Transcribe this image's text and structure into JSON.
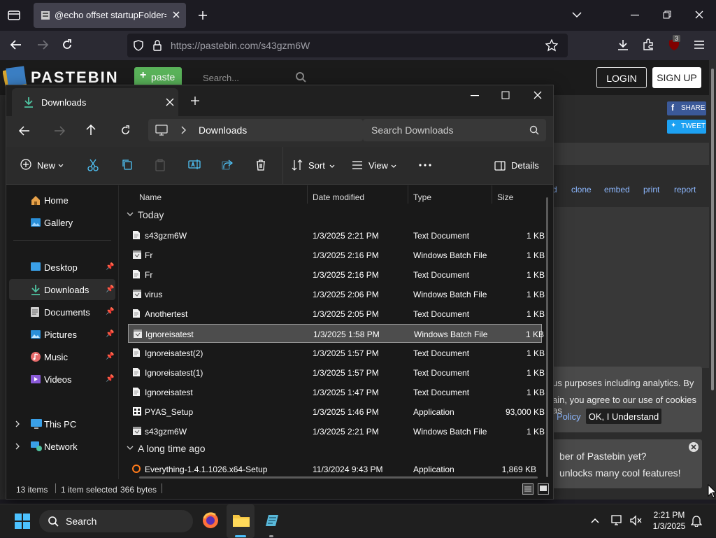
{
  "browser": {
    "tab_title": "@echo offset startupFolder=%",
    "url_host": "https://pastebin.com/",
    "url_path": "s43gzm6W",
    "badge_count": "3"
  },
  "pastebin": {
    "logo": "PASTEBIN",
    "paste_label": "paste",
    "search_placeholder": "Search...",
    "login_label": "LOGIN",
    "signup_label": "SIGN UP",
    "share_label": "SHARE",
    "tweet_label": "TWEET",
    "actions": [
      "d",
      "clone",
      "embed",
      "print",
      "report"
    ],
    "cookie_line1": "us purposes including analytics. By",
    "cookie_line2": "ain, you agree to our use of cookies as",
    "cookie_policy": "Policy",
    "cookie_ok": "OK, I Understand",
    "promo_line1": "ber of Pastebin yet?",
    "promo_line2": "unlocks many cool features!"
  },
  "explorer": {
    "tab_title": "Downloads",
    "breadcrumb": "Downloads",
    "search_placeholder": "Search Downloads",
    "commands": {
      "new": "New",
      "sort": "Sort",
      "view": "View",
      "details": "Details"
    },
    "sidebar": [
      {
        "label": "Home",
        "pinned": false
      },
      {
        "label": "Gallery",
        "pinned": false
      },
      {
        "label": "Desktop",
        "pinned": true
      },
      {
        "label": "Downloads",
        "pinned": true
      },
      {
        "label": "Documents",
        "pinned": true
      },
      {
        "label": "Pictures",
        "pinned": true
      },
      {
        "label": "Music",
        "pinned": true
      },
      {
        "label": "Videos",
        "pinned": true
      },
      {
        "label": "This PC",
        "pinned": false
      },
      {
        "label": "Network",
        "pinned": false
      }
    ],
    "columns": [
      "Name",
      "Date modified",
      "Type",
      "Size"
    ],
    "groups": {
      "today": "Today",
      "older": "A long time ago"
    },
    "files": [
      {
        "name": "s43gzm6W",
        "date": "1/3/2025 2:21 PM",
        "type": "Text Document",
        "size": "1 KB"
      },
      {
        "name": "Fr",
        "date": "1/3/2025 2:16 PM",
        "type": "Windows Batch File",
        "size": "1 KB"
      },
      {
        "name": "Fr",
        "date": "1/3/2025 2:16 PM",
        "type": "Text Document",
        "size": "1 KB"
      },
      {
        "name": "virus",
        "date": "1/3/2025 2:06 PM",
        "type": "Windows Batch File",
        "size": "1 KB"
      },
      {
        "name": "Anothertest",
        "date": "1/3/2025 2:05 PM",
        "type": "Text Document",
        "size": "1 KB"
      },
      {
        "name": "Ignoreisatest",
        "date": "1/3/2025 1:58 PM",
        "type": "Windows Batch File",
        "size": "1 KB"
      },
      {
        "name": "Ignoreisatest(2)",
        "date": "1/3/2025 1:57 PM",
        "type": "Text Document",
        "size": "1 KB"
      },
      {
        "name": "Ignoreisatest(1)",
        "date": "1/3/2025 1:57 PM",
        "type": "Text Document",
        "size": "1 KB"
      },
      {
        "name": "Ignoreisatest",
        "date": "1/3/2025 1:47 PM",
        "type": "Text Document",
        "size": "1 KB"
      },
      {
        "name": "PYAS_Setup",
        "date": "1/3/2025 1:46 PM",
        "type": "Application",
        "size": "93,000 KB"
      },
      {
        "name": "s43gzm6W",
        "date": "1/3/2025 2:21 PM",
        "type": "Windows Batch File",
        "size": "1 KB"
      }
    ],
    "older_files": [
      {
        "name": "Everything-1.4.1.1026.x64-Setup",
        "date": "11/3/2024 9:43 PM",
        "type": "Application",
        "size": "1,869 KB"
      }
    ],
    "status": {
      "items": "13 items",
      "selected": "1 item selected",
      "size": "366 bytes"
    }
  },
  "taskbar": {
    "search_label": "Search",
    "time": "2:21 PM",
    "date": "1/3/2025"
  }
}
